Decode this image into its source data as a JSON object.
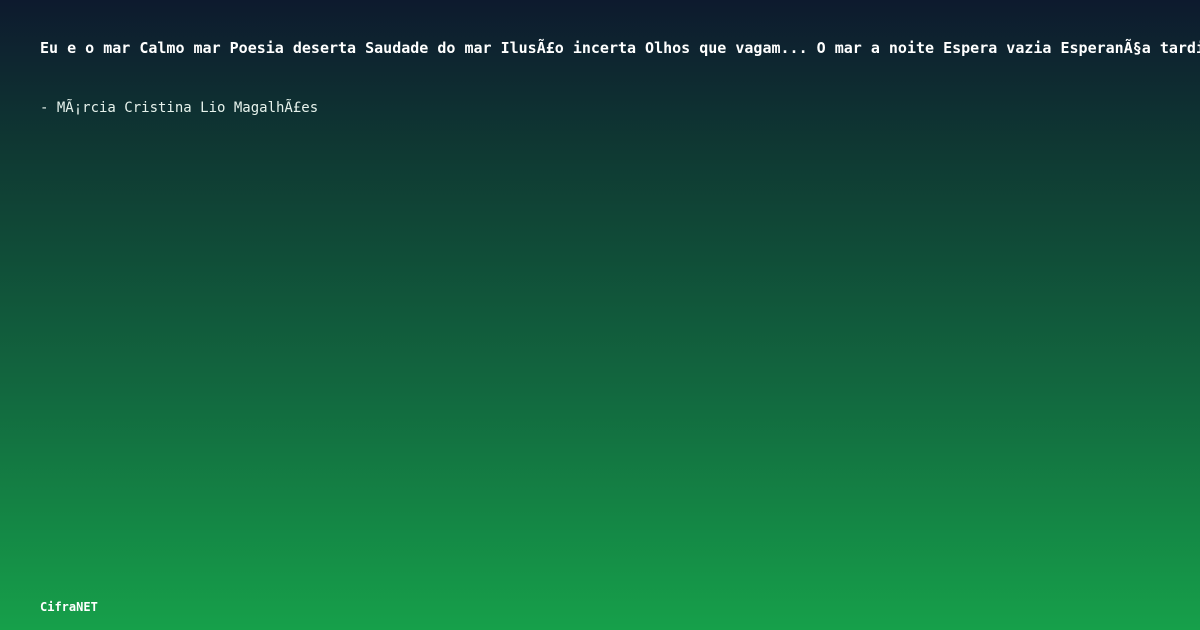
{
  "quote": {
    "text": "Eu e o mar Calmo mar Poesia deserta Saudade do mar IlusÃ£o incerta Olhos que vagam... O mar a noite Espera vazia EsperanÃ§a tardia"
  },
  "author": {
    "text": "- MÃ¡rcia Cristina Lio MagalhÃ£es"
  },
  "brand": {
    "name": "CifraNET"
  },
  "colors": {
    "gradient_top": "#0d1a2e",
    "gradient_bottom": "#16a04a",
    "text": "#ffffff"
  }
}
